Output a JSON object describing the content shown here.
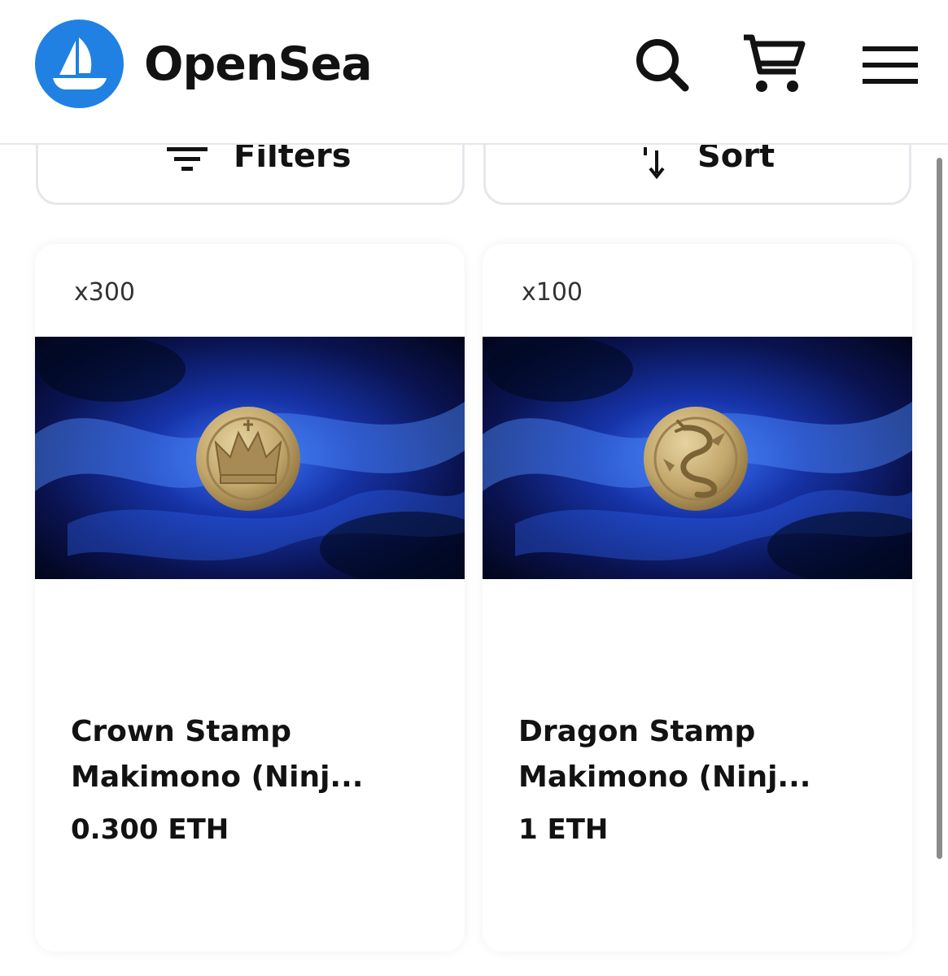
{
  "header": {
    "brand": "OpenSea",
    "icons": [
      "opensea-logo-icon",
      "search-icon",
      "cart-icon",
      "menu-icon"
    ],
    "brand_color": "#2081e2"
  },
  "toolbar": {
    "filters_label": "Filters",
    "sort_label": "Sort"
  },
  "items": [
    {
      "quantity": "x300",
      "title_line1": "Crown Stamp",
      "title_line2": "Makimono (Ninj...",
      "price": "0.300 ETH",
      "seal": "crown"
    },
    {
      "quantity": "x100",
      "title_line1": "Dragon Stamp",
      "title_line2": "Makimono (Ninj...",
      "price": "1 ETH",
      "seal": "dragon"
    }
  ]
}
